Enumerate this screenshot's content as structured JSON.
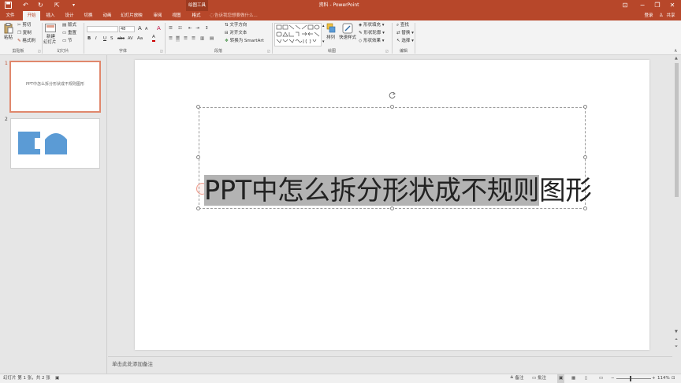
{
  "titlebar": {
    "ctx_group": "绘图工具",
    "doc_title": "资料 - PowerPoint",
    "quick_access": {
      "undo": "↶",
      "redo": "↻",
      "start": "⇱",
      "more": "▾"
    },
    "window": {
      "restore_ribbon": "⊡",
      "minimize": "−",
      "maximize": "❐",
      "close": "✕"
    }
  },
  "tabs": [
    "文件",
    "开始",
    "插入",
    "设计",
    "切换",
    "动画",
    "幻灯片放映",
    "审阅",
    "视图",
    "格式"
  ],
  "tellme": "告诉我您想要做什么...",
  "account": {
    "login": "登录",
    "share": "共享"
  },
  "ribbon": {
    "clipboard": {
      "paste": "粘贴",
      "cut": "剪切",
      "copy": "复制",
      "format_painter": "格式刷",
      "label": "剪贴板"
    },
    "slides": {
      "new_slide": "新建",
      "new_slide2": "幻灯片",
      "layout": "版式",
      "reset": "重置",
      "section": "节",
      "label": "幻灯片"
    },
    "font": {
      "family": "",
      "size": "48",
      "grow": "A",
      "shrink": "A",
      "clear": "A",
      "bold": "B",
      "italic": "I",
      "underline": "U",
      "shadow": "S",
      "strike": "abc",
      "spacing": "AV",
      "case": "Aa",
      "color": "A",
      "label": "字体"
    },
    "paragraph": {
      "text_direction": "文字方向",
      "align_text": "对齐文本",
      "smartart": "转换为 SmartArt",
      "label": "段落"
    },
    "drawing": {
      "arrange": "排列",
      "quick_styles": "快速样式",
      "fill": "形状填充",
      "outline": "形状轮廓",
      "effects": "形状效果",
      "label": "绘图"
    },
    "editing": {
      "find": "查找",
      "replace": "替换",
      "select": "选择",
      "label": "编辑"
    }
  },
  "thumbs": [
    {
      "num": "1",
      "text": "PPT中怎么拆分形状成不规则图形"
    },
    {
      "num": "2",
      "text": ""
    }
  ],
  "slide": {
    "text_selected": "PPT中怎么拆分形状成不规则",
    "text_rest": "图形"
  },
  "notes": "单击此处添加备注",
  "status": {
    "slide_info": "幻灯片 第 1 张，共 2 张",
    "notes_btn": "备注",
    "comments_btn": "批注",
    "zoom": "114%"
  },
  "colors": {
    "accent": "#b7472a",
    "shape": "#5b9bd5",
    "selection": "#b3b3b3"
  }
}
